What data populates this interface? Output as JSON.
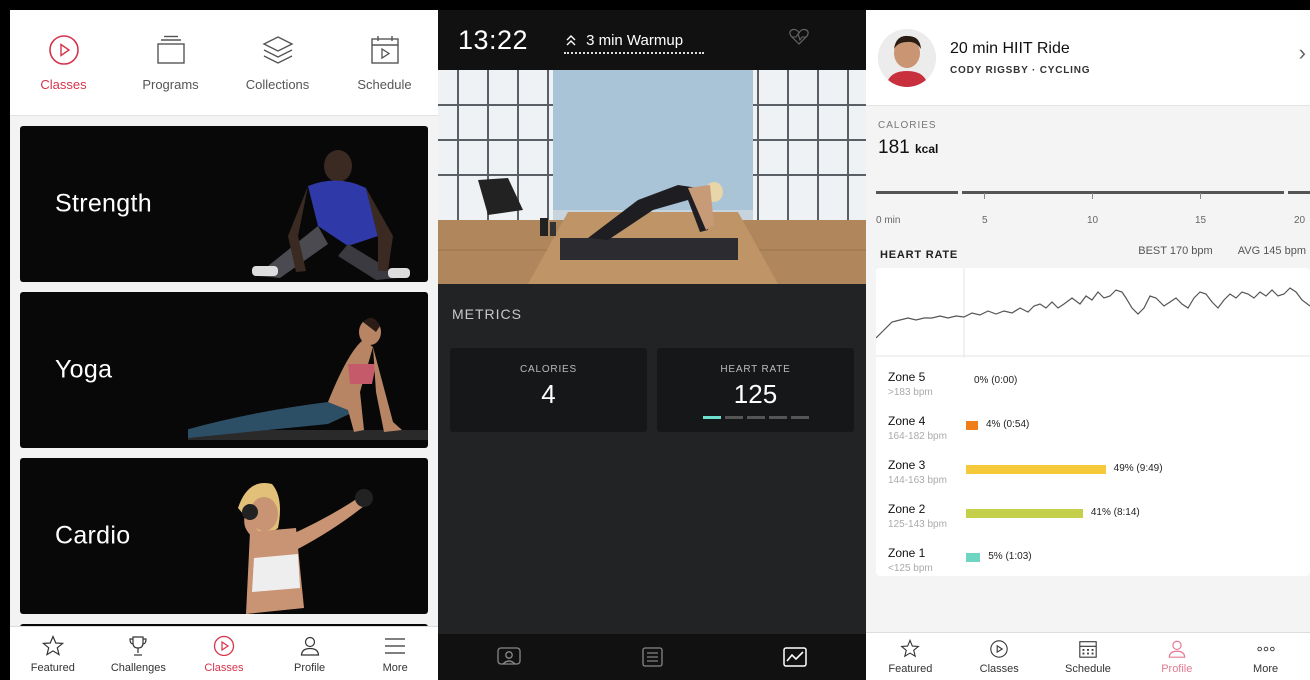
{
  "left": {
    "top_tabs": [
      {
        "label": "Classes",
        "icon": "play-circle-icon",
        "active": true
      },
      {
        "label": "Programs",
        "icon": "stack-icon",
        "active": false
      },
      {
        "label": "Collections",
        "icon": "layers-icon",
        "active": false
      },
      {
        "label": "Schedule",
        "icon": "calendar-icon",
        "active": false
      }
    ],
    "categories": [
      "Strength",
      "Yoga",
      "Cardio"
    ],
    "bottom_nav": [
      {
        "label": "Featured",
        "icon": "star-icon"
      },
      {
        "label": "Challenges",
        "icon": "trophy-icon"
      },
      {
        "label": "Classes",
        "icon": "play-circle-icon",
        "active": true
      },
      {
        "label": "Profile",
        "icon": "profile-icon"
      },
      {
        "label": "More",
        "icon": "menu-icon"
      }
    ]
  },
  "mid": {
    "clock": "13:22",
    "segment": "3 min Warmup",
    "metrics_title": "METRICS",
    "metrics": [
      {
        "label": "CALORIES",
        "value": "4"
      },
      {
        "label": "HEART RATE",
        "value": "125"
      }
    ],
    "bottom_nav": [
      "camera-icon",
      "list-icon",
      "chart-icon"
    ]
  },
  "right": {
    "title": "20 min HIIT Ride",
    "subtitle": "CODY RIGSBY · CYCLING",
    "calories_label": "CALORIES",
    "calories_value": "181",
    "calories_unit": "kcal",
    "timeline_labels": [
      "0 min",
      "5",
      "10",
      "15",
      "20"
    ],
    "heart_rate_title": "HEART RATE",
    "best": "BEST  170 bpm",
    "avg": "AVG  145 bpm",
    "zones": [
      {
        "name": "Zone 5",
        "range": ">183 bpm",
        "pct": "0% (0:00)",
        "share": 0,
        "color": "#e9e9e9"
      },
      {
        "name": "Zone 4",
        "range": "164-182 bpm",
        "pct": "4% (0:54)",
        "share": 4,
        "color": "#ef7d1a"
      },
      {
        "name": "Zone 3",
        "range": "144-163 bpm",
        "pct": "49% (9:49)",
        "share": 49,
        "color": "#f5c93a"
      },
      {
        "name": "Zone 2",
        "range": "125-143 bpm",
        "pct": "41% (8:14)",
        "share": 41,
        "color": "#c5d04a"
      },
      {
        "name": "Zone 1",
        "range": "<125 bpm",
        "pct": "5% (1:03)",
        "share": 5,
        "color": "#6fd4c1"
      }
    ],
    "bottom_nav": [
      {
        "label": "Featured",
        "icon": "star-icon"
      },
      {
        "label": "Classes",
        "icon": "play-circle-icon"
      },
      {
        "label": "Schedule",
        "icon": "calendar-icon"
      },
      {
        "label": "Profile",
        "icon": "profile-icon",
        "active": true
      },
      {
        "label": "More",
        "icon": "more-dots-icon"
      }
    ]
  },
  "colors": {
    "accent": "#d6334a",
    "profile_active": "#e37a92",
    "hr_line": "#555555"
  }
}
